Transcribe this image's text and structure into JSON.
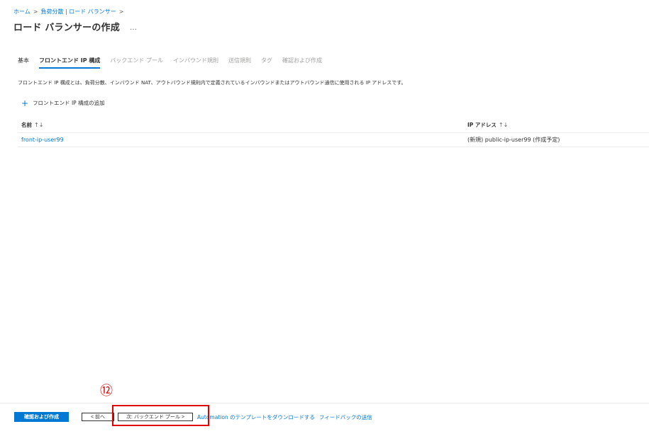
{
  "breadcrumb": {
    "items": [
      "ホーム",
      "負荷分散 | ロード バランサー"
    ],
    "separator": ">"
  },
  "header": {
    "title": "ロード バランサーの作成",
    "more": "…"
  },
  "tabs": [
    {
      "label": "基本",
      "state": "done"
    },
    {
      "label": "フロントエンド IP 構成",
      "state": "active"
    },
    {
      "label": "バックエンド プール",
      "state": "disabled"
    },
    {
      "label": "インバウンド規則",
      "state": "disabled"
    },
    {
      "label": "送信規則",
      "state": "disabled"
    },
    {
      "label": "タグ",
      "state": "disabled"
    },
    {
      "label": "確認および作成",
      "state": "disabled"
    }
  ],
  "description": "フロントエンド IP 構成とは、負荷分散、インバウンド NAT、アウトバウンド規則内で定義されているインバウンドまたはアウトバウンド通信に使用される IP アドレスです。",
  "add_action": {
    "icon": "plus-icon",
    "label": "フロントエンド IP 構成の追加"
  },
  "table": {
    "columns": [
      {
        "label": "名前",
        "sort": "↑↓"
      },
      {
        "label": "IP アドレス",
        "sort": "↑↓"
      }
    ],
    "rows": [
      {
        "name": "front-ip-user99",
        "ip": "(新規) public-ip-user99 (作成予定)"
      }
    ]
  },
  "footer": {
    "review_create": "確認および作成",
    "prev": "< 前へ",
    "next": "次: バックエンド プール >",
    "automation_link": "Automation のテンプレートをダウンロードする",
    "feedback_link": "フィードバックの送信"
  },
  "annotation": {
    "number": "⑫",
    "color": "#e00000"
  },
  "colors": {
    "accent": "#0078d4",
    "text": "#323130",
    "disabled": "#a19f9d"
  }
}
